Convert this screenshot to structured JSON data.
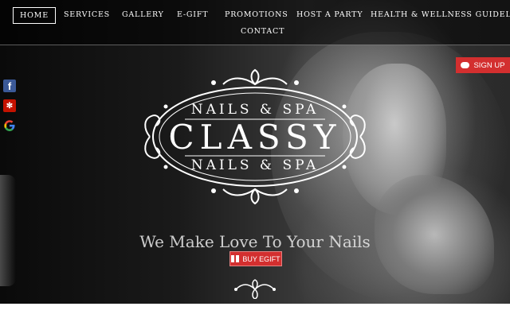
{
  "nav": {
    "items": [
      {
        "label": "HOME",
        "active": true
      },
      {
        "label": "SERVICES"
      },
      {
        "label": "GALLERY"
      },
      {
        "label": "E-GIFT"
      },
      {
        "label": "PROMOTIONS"
      },
      {
        "label": "HOST A PARTY"
      },
      {
        "label": "HEALTH & WELLNESS GUIDELINES"
      },
      {
        "label": "CONTACT"
      }
    ]
  },
  "signup": {
    "label": "SIGN UP",
    "icon": "chat-bubble-icon"
  },
  "social": [
    {
      "name": "facebook-icon",
      "glyph": "f"
    },
    {
      "name": "yelp-icon",
      "glyph": "✻"
    },
    {
      "name": "google-icon",
      "glyph": "G"
    }
  ],
  "logo": {
    "top": "NAILS & SPA",
    "main": "CLASSY",
    "bottom": "NAILS & SPA"
  },
  "hero": {
    "tagline": "We Make Love To Your Nails",
    "buy_label": "BUY EGIFT"
  },
  "colors": {
    "accent": "#d32f2f",
    "facebook": "#3b5998",
    "yelp": "#c41200"
  }
}
